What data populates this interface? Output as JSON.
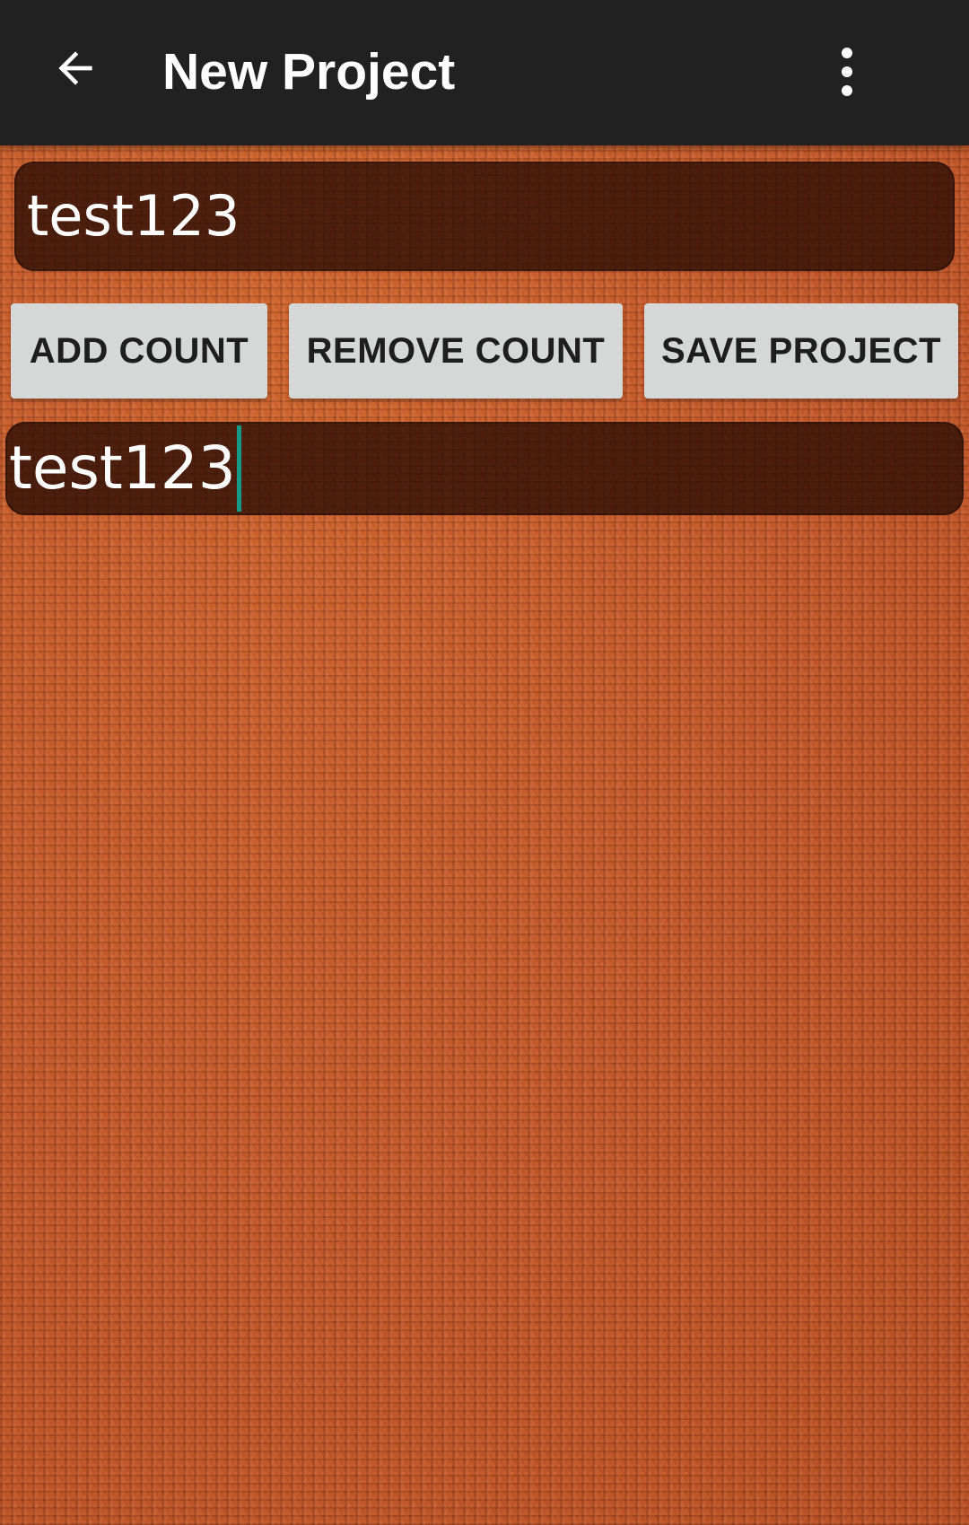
{
  "app_bar": {
    "title": "New Project",
    "back_icon": "arrow-left-icon",
    "overflow_icon": "more-vertical-icon",
    "background_color": "#212121"
  },
  "project_name": {
    "value": "test123"
  },
  "actions": {
    "add_count_label": "ADD COUNT",
    "remove_count_label": "REMOVE COUNT",
    "save_project_label": "SAVE PROJECT",
    "button_color": "#d6d7d7"
  },
  "count_field": {
    "value": "test123",
    "cursor_color": "#159a85"
  },
  "background": {
    "texture": "orange-knit",
    "color": "#c85a26"
  }
}
